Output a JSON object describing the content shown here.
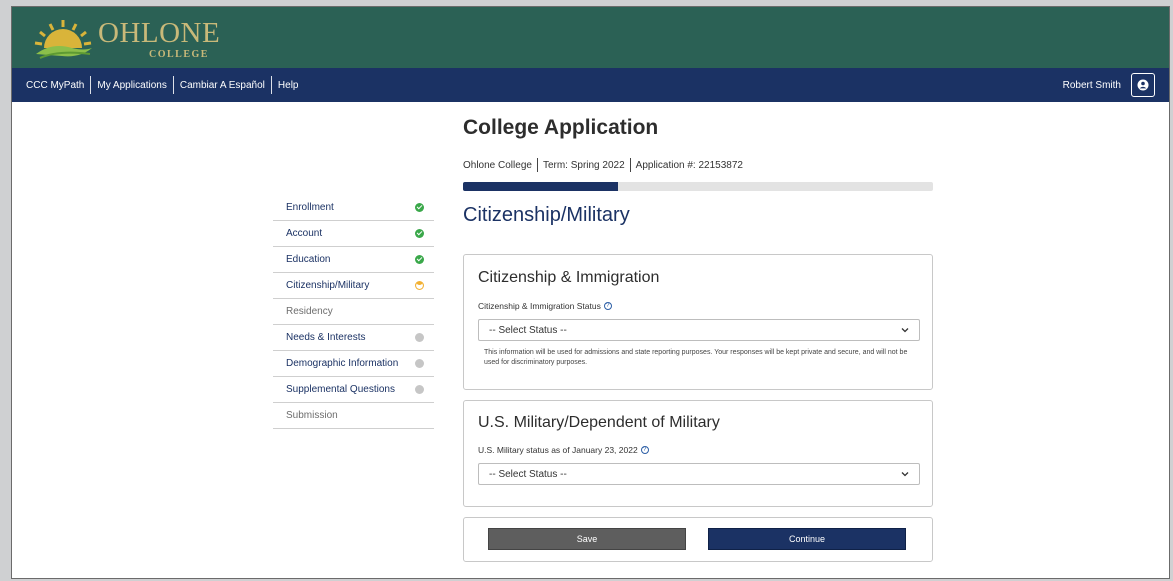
{
  "brand": {
    "name": "OHLONE",
    "sub": "COLLEGE",
    "bar_color": "#2b6155",
    "text_color": "#c9b979"
  },
  "nav": {
    "links": [
      "CCC MyPath",
      "My Applications",
      "Cambiar A Español",
      "Help"
    ],
    "user_name": "Robert Smith",
    "user_icon": "user-icon",
    "bar_color": "#1b3264"
  },
  "page": {
    "title": "College Application",
    "college": "Ohlone College",
    "term": "Term: Spring 2022",
    "application": "Application #: 22153872",
    "progress_fraction": 0.33,
    "section_title": "Citizenship/Military"
  },
  "steps": [
    {
      "label": "Enrollment",
      "status": "complete"
    },
    {
      "label": "Account",
      "status": "complete"
    },
    {
      "label": "Education",
      "status": "complete"
    },
    {
      "label": "Citizenship/Military",
      "status": "current"
    },
    {
      "label": "Residency",
      "status": "none"
    },
    {
      "label": "Needs & Interests",
      "status": "pending"
    },
    {
      "label": "Demographic Information",
      "status": "pending"
    },
    {
      "label": "Supplemental Questions",
      "status": "pending"
    },
    {
      "label": "Submission",
      "status": "none"
    }
  ],
  "citizenship": {
    "heading": "Citizenship & Immigration",
    "label": "Citizenship & Immigration Status",
    "select_value": "-- Select Status --",
    "hint": "This information will be used for admissions and state reporting purposes. Your responses will be kept private and secure, and will not be used for discriminatory purposes."
  },
  "military": {
    "heading": "U.S. Military/Dependent of Military",
    "label": "U.S. Military status as of January 23, 2022",
    "select_value": "-- Select Status --"
  },
  "actions": {
    "save": "Save",
    "continue": "Continue"
  }
}
